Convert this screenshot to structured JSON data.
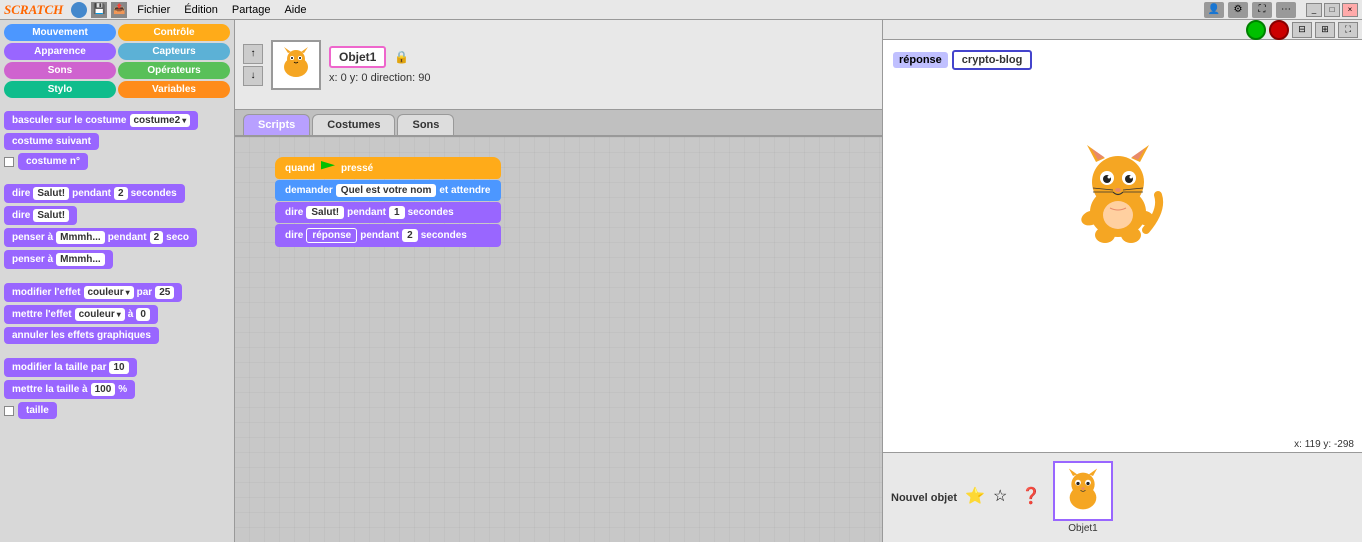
{
  "app": {
    "title": "SCRATCH",
    "menu": {
      "items": [
        "Fichier",
        "Édition",
        "Partage",
        "Aide"
      ]
    }
  },
  "categories": {
    "items": [
      {
        "label": "Mouvement",
        "class": "cat-mouvement"
      },
      {
        "label": "Contrôle",
        "class": "cat-controle"
      },
      {
        "label": "Apparence",
        "class": "cat-apparence"
      },
      {
        "label": "Capteurs",
        "class": "cat-capteurs"
      },
      {
        "label": "Sons",
        "class": "cat-sons"
      },
      {
        "label": "Opérateurs",
        "class": "cat-operateurs"
      },
      {
        "label": "Stylo",
        "class": "cat-stylo"
      },
      {
        "label": "Variables",
        "class": "cat-variables"
      }
    ]
  },
  "blocks": {
    "costume_switch": "basculer sur le costume",
    "costume_switch_val": "costume2",
    "next_costume": "costume suivant",
    "costume_num": "costume n°",
    "say_seconds": "dire",
    "say_seconds_val1": "Salut!",
    "say_seconds_pendant": "pendant",
    "say_seconds_val2": "2",
    "say_seconds_unit": "secondes",
    "say": "dire",
    "say_val": "Salut!",
    "think_seconds": "penser à",
    "think_val": "Mmmh...",
    "think_pendant": "pendant",
    "think_sec_val": "2",
    "think_sec_unit": "seco",
    "think2": "penser à",
    "think2_val": "Mmmh...",
    "effect_modify": "modifier l'effet",
    "effect_type": "couleur",
    "effect_by": "par",
    "effect_val": "25",
    "effect_set": "mettre l'effet",
    "effect_type2": "couleur",
    "effect_set_to": "à",
    "effect_set_val": "0",
    "effect_clear": "annuler les effets graphiques",
    "size_modify": "modifier la taille par",
    "size_val": "10",
    "size_set": "mettre la taille à",
    "size_set_val": "100",
    "size_percent": "%",
    "size_show": "taille"
  },
  "sprite": {
    "name": "Objet1",
    "x": "0",
    "y": "0",
    "direction": "90",
    "coords_label": "x: 0   y: 0   direction: 90"
  },
  "tabs": {
    "scripts": "Scripts",
    "costumes": "Costumes",
    "sons": "Sons"
  },
  "script_blocks": {
    "when_flag": "quand",
    "when_flag2": "pressé",
    "ask": "demander",
    "ask_val": "Quel est votre nom",
    "ask_wait": "et attendre",
    "say_b1": "dire",
    "say_b1_val": "Salut!",
    "say_b1_pendant": "pendant",
    "say_b1_sec": "1",
    "say_b1_unit": "secondes",
    "say_b2": "dire",
    "say_b2_val": "réponse",
    "say_b2_pendant": "pendant",
    "say_b2_sec": "2",
    "say_b2_unit": "secondes"
  },
  "stage": {
    "response_label": "réponse",
    "response_value": "crypto-blog",
    "coords": "x: 119   y: -298"
  },
  "sprite_panel": {
    "title": "Nouvel objet",
    "sprite_name": "Objet1"
  }
}
